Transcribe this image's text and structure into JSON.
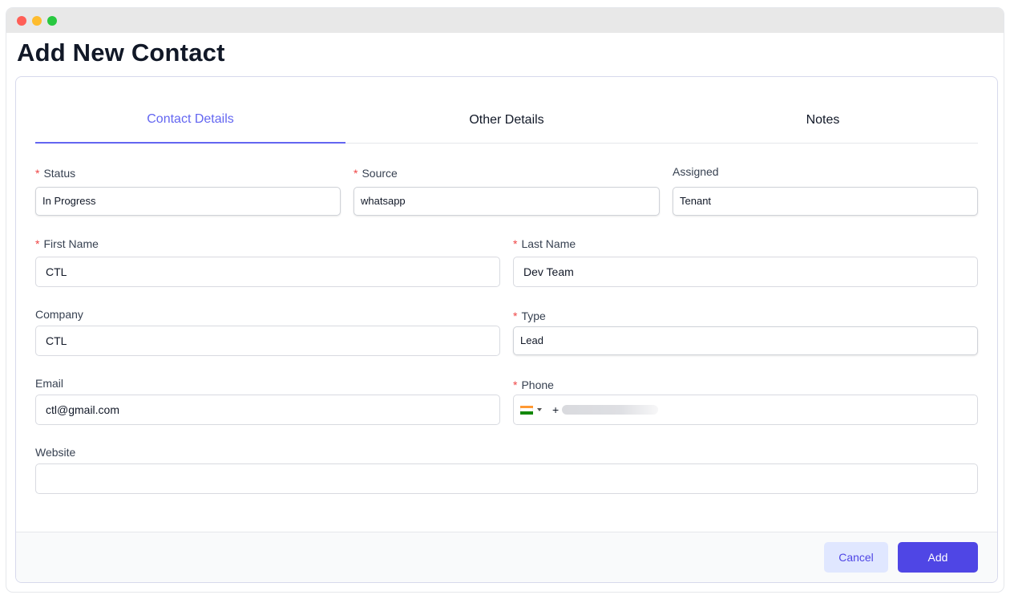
{
  "page": {
    "title": "Add New Contact"
  },
  "tabs": [
    {
      "label": "Contact Details",
      "active": true
    },
    {
      "label": "Other Details",
      "active": false
    },
    {
      "label": "Notes",
      "active": false
    }
  ],
  "form": {
    "status": {
      "label": "Status",
      "required": true,
      "value": "In Progress"
    },
    "source": {
      "label": "Source",
      "required": true,
      "value": "whatsapp"
    },
    "assigned": {
      "label": "Assigned",
      "required": false,
      "value": "Tenant"
    },
    "first_name": {
      "label": "First Name",
      "required": true,
      "value": "CTL"
    },
    "last_name": {
      "label": "Last Name",
      "required": true,
      "value": "Dev Team"
    },
    "company": {
      "label": "Company",
      "required": false,
      "value": "CTL"
    },
    "type": {
      "label": "Type",
      "required": true,
      "value": "Lead"
    },
    "email": {
      "label": "Email",
      "required": false,
      "value": "ctl@gmail.com"
    },
    "phone": {
      "label": "Phone",
      "required": true,
      "prefix": "+",
      "country_flag": "india-flag-icon"
    },
    "website": {
      "label": "Website",
      "required": false,
      "value": ""
    }
  },
  "footer": {
    "cancel_label": "Cancel",
    "add_label": "Add"
  },
  "colors": {
    "accent": "#4f46e5",
    "tab_active": "#6366f1",
    "required": "#ef4444"
  }
}
